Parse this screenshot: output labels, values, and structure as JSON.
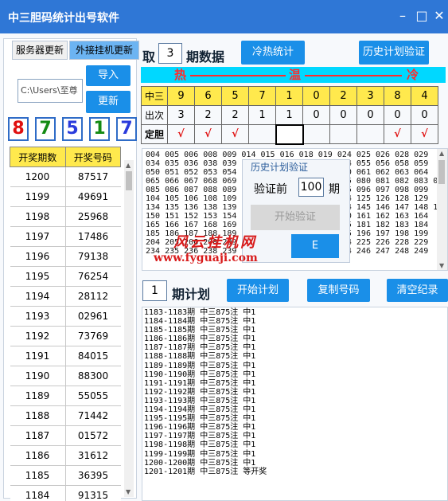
{
  "window": {
    "title": "中三胆码统计出号软件",
    "minimize_icon": "minimize-icon",
    "maximize_icon": "maximize-icon",
    "close_icon": "close-icon"
  },
  "left": {
    "tabs": [
      "服务器更新",
      "外接挂机更新"
    ],
    "path_value": "C:\\Users\\至尊",
    "import_label": "导入",
    "update_label": "更新",
    "digits": [
      "8",
      "7",
      "5",
      "1",
      "7"
    ],
    "digit_colors": [
      "#e01010",
      "#138a13",
      "#2a3bdc",
      "#138a13",
      "#2a3bdc"
    ],
    "table_headers": [
      "开奖期数",
      "开奖号码"
    ],
    "rows": [
      [
        "1200",
        "87517"
      ],
      [
        "1199",
        "49691"
      ],
      [
        "1198",
        "25968"
      ],
      [
        "1197",
        "17486"
      ],
      [
        "1196",
        "79138"
      ],
      [
        "1195",
        "76254"
      ],
      [
        "1194",
        "28112"
      ],
      [
        "1193",
        "02961"
      ],
      [
        "1192",
        "73769"
      ],
      [
        "1191",
        "84015"
      ],
      [
        "1190",
        "88300"
      ],
      [
        "1189",
        "55055"
      ],
      [
        "1188",
        "71442"
      ],
      [
        "1187",
        "01572"
      ],
      [
        "1186",
        "31612"
      ],
      [
        "1185",
        "36395"
      ],
      [
        "1184",
        "91315"
      ]
    ]
  },
  "top": {
    "take_label": "取",
    "period_count": "3",
    "period_label": "期数据",
    "hotcold_btn": "冷热统计",
    "history_btn": "历史计划验证"
  },
  "stats": {
    "hot": "热",
    "warm": "温",
    "cold": "冷",
    "row_labels": [
      "中三",
      "出次",
      "定胆"
    ],
    "digits": [
      "9",
      "6",
      "5",
      "7",
      "1",
      "0",
      "2",
      "3",
      "8",
      "4"
    ],
    "counts": [
      "3",
      "2",
      "2",
      "1",
      "1",
      "0",
      "0",
      "0",
      "0",
      "0"
    ],
    "marks": [
      "√",
      "√",
      "√",
      "",
      "",
      "",
      "",
      "",
      "√",
      "√"
    ]
  },
  "numbers": {
    "text": "004 005 006 008 009 014 015 016 018 019 024 025 026 028 029\n034 035 036 038 039 044 045 046 048 049 054 055 056 058 059\n050 051 052 053 054 055 056 057 058 059 060 061 062 063 064\n065 066 067 068 069 070 071 072 073 074 075 080 081 082 083 084\n085 086 087 088 089 090 091 092 093 094 095 096 097 098 099\n104 105 106 108 109 114 115 116 118 119 124 125 126 128 129\n134 135 136 138 139 144 145 146 148 149 154 145 146 147 148 149\n150 151 152 153 154 155 156 157 158 159 160 161 162 163 164\n165 166 167 168 169 170 171 172 173 174 175 181 182 183 184\n185 186 187 188 189 190 191 192 193 194 195 196 197 198 199\n204 205 206 208 209 214 215 216 218 219 224 225 226 228 229\n234 235 236 238 239 244 245 246 248 249 254 246 247 248 249"
  },
  "history_dialog": {
    "title": "历史计划验证",
    "verify_prefix": "验证前",
    "verify_count": "100",
    "verify_suffix": "期",
    "start_btn": "开始验证"
  },
  "watermark": {
    "line1": "风云挂机网",
    "line2": "www.fyguaji.com"
  },
  "plan": {
    "count": "1",
    "label": "期计划",
    "start_btn": "开始计划",
    "copy_btn": "复制号码",
    "clear_btn": "清空纪录",
    "lines": [
      "1183-1183期 中三875注 中1",
      "1184-1184期 中三875注 中1",
      "1185-1185期 中三875注 中1",
      "1186-1186期 中三875注 中1",
      "1187-1187期 中三875注 中1",
      "1188-1188期 中三875注 中1",
      "1189-1189期 中三875注 中1",
      "1190-1190期 中三875注 中1",
      "1191-1191期 中三875注 中1",
      "1192-1192期 中三875注 中1",
      "1193-1193期 中三875注 中1",
      "1194-1194期 中三875注 中1",
      "1195-1195期 中三875注 中1",
      "1196-1196期 中三875注 中1",
      "1197-1197期 中三875注 中1",
      "1198-1198期 中三875注 中1",
      "1199-1199期 中三875注 中1",
      "1200-1200期 中三875注 中1",
      "1201-1201期 中三875注 等开奖"
    ]
  }
}
